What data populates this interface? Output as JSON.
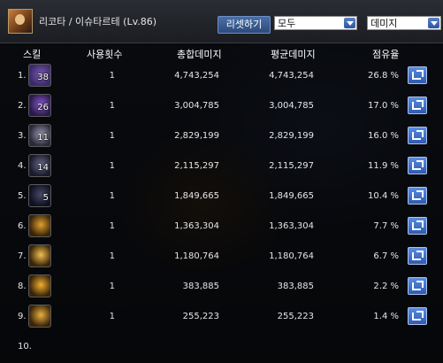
{
  "window": {
    "title": "리코타 / 이슈타르테 (Lv.86)",
    "reset_label": "리셋하기",
    "filter_select": "모두",
    "mode_select": "데미지"
  },
  "table": {
    "headers": [
      "스킬",
      "사용횟수",
      "총합데미지",
      "평균데미지",
      "점유율"
    ],
    "rows": [
      {
        "index": "1.",
        "skill_level": "38",
        "count": "1",
        "total": "4,743,254",
        "average": "4,743,254",
        "share": "26.8 %",
        "icon": "dark-swirl-skill-icon",
        "colors": [
          "#3a2a6a",
          "#7a5ab0"
        ]
      },
      {
        "index": "2.",
        "skill_level": "26",
        "count": "1",
        "total": "3,004,785",
        "average": "3,004,785",
        "share": "17.0 %",
        "icon": "purple-slash-skill-icon",
        "colors": [
          "#2a1a4a",
          "#8a5ad0"
        ]
      },
      {
        "index": "3.",
        "skill_level": "11",
        "count": "1",
        "total": "2,829,199",
        "average": "2,829,199",
        "share": "16.0 %",
        "icon": "shadow-burst-skill-icon",
        "colors": [
          "#2a2a3a",
          "#9a9ab0"
        ]
      },
      {
        "index": "4.",
        "skill_level": "14",
        "count": "1",
        "total": "2,115,297",
        "average": "2,115,297",
        "share": "11.9 %",
        "icon": "dark-arrow-skill-icon",
        "colors": [
          "#1a1a2a",
          "#6a6a8a"
        ]
      },
      {
        "index": "5.",
        "skill_level": "5",
        "count": "1",
        "total": "1,849,665",
        "average": "1,849,665",
        "share": "10.4 %",
        "icon": "night-wave-skill-icon",
        "colors": [
          "#101020",
          "#4a4a6a"
        ]
      },
      {
        "index": "6.",
        "skill_level": "",
        "count": "1",
        "total": "1,363,304",
        "average": "1,363,304",
        "share": "7.7 %",
        "icon": "golden-claw-skill-icon",
        "colors": [
          "#3a2408",
          "#e0a030"
        ]
      },
      {
        "index": "7.",
        "skill_level": "",
        "count": "1",
        "total": "1,180,764",
        "average": "1,180,764",
        "share": "6.7 %",
        "icon": "golden-bat-skill-icon",
        "colors": [
          "#3a2408",
          "#f0c050"
        ]
      },
      {
        "index": "8.",
        "skill_level": "",
        "count": "1",
        "total": "383,885",
        "average": "383,885",
        "share": "2.2 %",
        "icon": "golden-flame-skill-icon",
        "colors": [
          "#3a2408",
          "#f0b030"
        ]
      },
      {
        "index": "9.",
        "skill_level": "",
        "count": "1",
        "total": "255,223",
        "average": "255,223",
        "share": "1.4 %",
        "icon": "golden-crescent-skill-icon",
        "colors": [
          "#3a2408",
          "#e8b040"
        ]
      },
      {
        "index": "10.",
        "skill_level": "",
        "count": "",
        "total": "",
        "average": "",
        "share": "",
        "icon": "",
        "colors": [
          "transparent",
          "transparent"
        ]
      }
    ]
  }
}
